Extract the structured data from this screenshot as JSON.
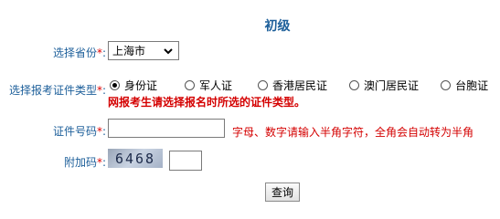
{
  "title": "初级",
  "required_mark": "*",
  "colon": ":",
  "province": {
    "label": "选择省份",
    "selected": "上海市"
  },
  "id_type": {
    "label": "选择报考证件类型",
    "options": [
      "身份证",
      "军人证",
      "香港居民证",
      "澳门居民证",
      "台胞证"
    ],
    "selected_index": 0,
    "warning": "网报考生请选择报名时所选的证件类型。"
  },
  "id_number": {
    "label": "证件号码",
    "value": "",
    "hint": "字母、数字请输入半角字符，全角会自动转为半角"
  },
  "captcha": {
    "label": "附加码",
    "image_text": "6468",
    "value": ""
  },
  "submit_label": "查询",
  "colors": {
    "label": "#1d5f9a",
    "required": "#e00000",
    "warning": "#d40000"
  }
}
